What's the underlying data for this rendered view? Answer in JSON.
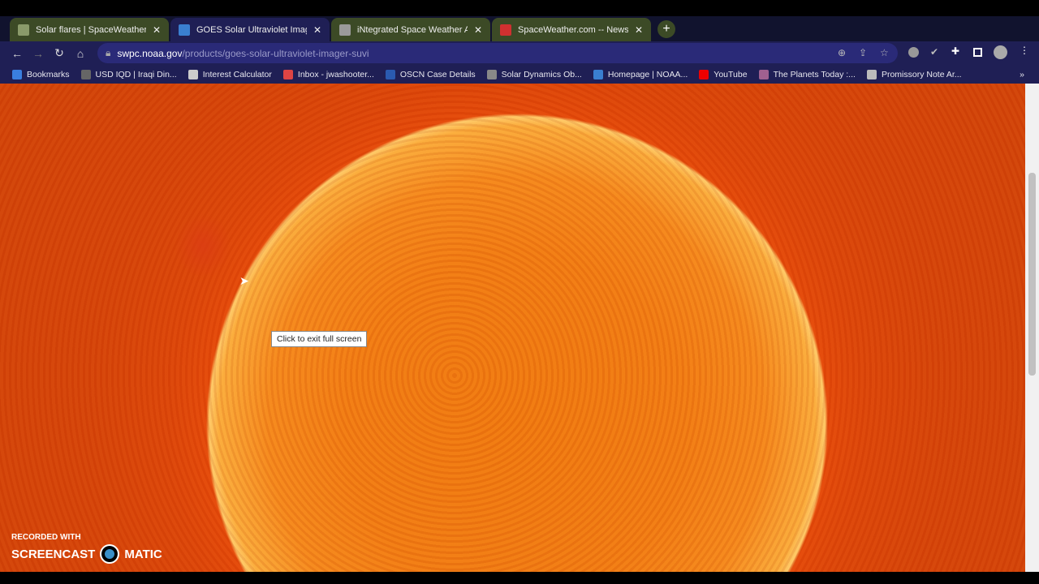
{
  "tabs": [
    {
      "title": "Solar flares | SpaceWeatherLive.com",
      "fav": "#8a9a6a",
      "active": false
    },
    {
      "title": "GOES Solar Ultraviolet Imager (SUVI)",
      "fav": "#3a7fd0",
      "active": true
    },
    {
      "title": "iNtegrated Space Weather Analysis",
      "fav": "#9a9a9a",
      "active": false
    },
    {
      "title": "SpaceWeather.com -- News and information",
      "fav": "#d03030",
      "active": false
    }
  ],
  "address": {
    "host": "swpc.noaa.gov",
    "path": "/products/goes-solar-ultraviolet-imager-suvi"
  },
  "bookmarks": [
    {
      "label": "Bookmarks",
      "color": "#3a7fe0"
    },
    {
      "label": "USD IQD | Iraqi Din...",
      "color": "#666"
    },
    {
      "label": "Interest Calculator",
      "color": "#ccc"
    },
    {
      "label": "Inbox - jwashooter...",
      "color": "#d44"
    },
    {
      "label": "OSCN Case Details",
      "color": "#2a5ab0"
    },
    {
      "label": "Solar Dynamics Ob...",
      "color": "#888"
    },
    {
      "label": "Homepage | NOAA...",
      "color": "#3a7fd0"
    },
    {
      "label": "YouTube",
      "color": "#e00"
    },
    {
      "label": "The Planets Today :...",
      "color": "#a06090"
    },
    {
      "label": "Promissory Note Ar...",
      "color": "#bbb"
    }
  ],
  "tooltip": "Click to exit full screen",
  "watermark": {
    "line1": "RECORDED WITH",
    "left": "SCREENCAST",
    "right": "MATIC"
  }
}
